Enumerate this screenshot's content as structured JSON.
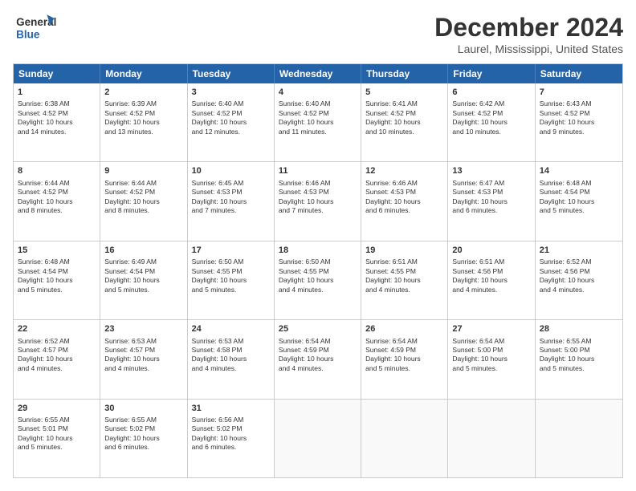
{
  "logo": {
    "line1": "General",
    "line2": "Blue"
  },
  "title": "December 2024",
  "location": "Laurel, Mississippi, United States",
  "days_of_week": [
    "Sunday",
    "Monday",
    "Tuesday",
    "Wednesday",
    "Thursday",
    "Friday",
    "Saturday"
  ],
  "weeks": [
    [
      {
        "day": "1",
        "lines": [
          "Sunrise: 6:38 AM",
          "Sunset: 4:52 PM",
          "Daylight: 10 hours",
          "and 14 minutes."
        ]
      },
      {
        "day": "2",
        "lines": [
          "Sunrise: 6:39 AM",
          "Sunset: 4:52 PM",
          "Daylight: 10 hours",
          "and 13 minutes."
        ]
      },
      {
        "day": "3",
        "lines": [
          "Sunrise: 6:40 AM",
          "Sunset: 4:52 PM",
          "Daylight: 10 hours",
          "and 12 minutes."
        ]
      },
      {
        "day": "4",
        "lines": [
          "Sunrise: 6:40 AM",
          "Sunset: 4:52 PM",
          "Daylight: 10 hours",
          "and 11 minutes."
        ]
      },
      {
        "day": "5",
        "lines": [
          "Sunrise: 6:41 AM",
          "Sunset: 4:52 PM",
          "Daylight: 10 hours",
          "and 10 minutes."
        ]
      },
      {
        "day": "6",
        "lines": [
          "Sunrise: 6:42 AM",
          "Sunset: 4:52 PM",
          "Daylight: 10 hours",
          "and 10 minutes."
        ]
      },
      {
        "day": "7",
        "lines": [
          "Sunrise: 6:43 AM",
          "Sunset: 4:52 PM",
          "Daylight: 10 hours",
          "and 9 minutes."
        ]
      }
    ],
    [
      {
        "day": "8",
        "lines": [
          "Sunrise: 6:44 AM",
          "Sunset: 4:52 PM",
          "Daylight: 10 hours",
          "and 8 minutes."
        ]
      },
      {
        "day": "9",
        "lines": [
          "Sunrise: 6:44 AM",
          "Sunset: 4:52 PM",
          "Daylight: 10 hours",
          "and 8 minutes."
        ]
      },
      {
        "day": "10",
        "lines": [
          "Sunrise: 6:45 AM",
          "Sunset: 4:53 PM",
          "Daylight: 10 hours",
          "and 7 minutes."
        ]
      },
      {
        "day": "11",
        "lines": [
          "Sunrise: 6:46 AM",
          "Sunset: 4:53 PM",
          "Daylight: 10 hours",
          "and 7 minutes."
        ]
      },
      {
        "day": "12",
        "lines": [
          "Sunrise: 6:46 AM",
          "Sunset: 4:53 PM",
          "Daylight: 10 hours",
          "and 6 minutes."
        ]
      },
      {
        "day": "13",
        "lines": [
          "Sunrise: 6:47 AM",
          "Sunset: 4:53 PM",
          "Daylight: 10 hours",
          "and 6 minutes."
        ]
      },
      {
        "day": "14",
        "lines": [
          "Sunrise: 6:48 AM",
          "Sunset: 4:54 PM",
          "Daylight: 10 hours",
          "and 5 minutes."
        ]
      }
    ],
    [
      {
        "day": "15",
        "lines": [
          "Sunrise: 6:48 AM",
          "Sunset: 4:54 PM",
          "Daylight: 10 hours",
          "and 5 minutes."
        ]
      },
      {
        "day": "16",
        "lines": [
          "Sunrise: 6:49 AM",
          "Sunset: 4:54 PM",
          "Daylight: 10 hours",
          "and 5 minutes."
        ]
      },
      {
        "day": "17",
        "lines": [
          "Sunrise: 6:50 AM",
          "Sunset: 4:55 PM",
          "Daylight: 10 hours",
          "and 5 minutes."
        ]
      },
      {
        "day": "18",
        "lines": [
          "Sunrise: 6:50 AM",
          "Sunset: 4:55 PM",
          "Daylight: 10 hours",
          "and 4 minutes."
        ]
      },
      {
        "day": "19",
        "lines": [
          "Sunrise: 6:51 AM",
          "Sunset: 4:55 PM",
          "Daylight: 10 hours",
          "and 4 minutes."
        ]
      },
      {
        "day": "20",
        "lines": [
          "Sunrise: 6:51 AM",
          "Sunset: 4:56 PM",
          "Daylight: 10 hours",
          "and 4 minutes."
        ]
      },
      {
        "day": "21",
        "lines": [
          "Sunrise: 6:52 AM",
          "Sunset: 4:56 PM",
          "Daylight: 10 hours",
          "and 4 minutes."
        ]
      }
    ],
    [
      {
        "day": "22",
        "lines": [
          "Sunrise: 6:52 AM",
          "Sunset: 4:57 PM",
          "Daylight: 10 hours",
          "and 4 minutes."
        ]
      },
      {
        "day": "23",
        "lines": [
          "Sunrise: 6:53 AM",
          "Sunset: 4:57 PM",
          "Daylight: 10 hours",
          "and 4 minutes."
        ]
      },
      {
        "day": "24",
        "lines": [
          "Sunrise: 6:53 AM",
          "Sunset: 4:58 PM",
          "Daylight: 10 hours",
          "and 4 minutes."
        ]
      },
      {
        "day": "25",
        "lines": [
          "Sunrise: 6:54 AM",
          "Sunset: 4:59 PM",
          "Daylight: 10 hours",
          "and 4 minutes."
        ]
      },
      {
        "day": "26",
        "lines": [
          "Sunrise: 6:54 AM",
          "Sunset: 4:59 PM",
          "Daylight: 10 hours",
          "and 5 minutes."
        ]
      },
      {
        "day": "27",
        "lines": [
          "Sunrise: 6:54 AM",
          "Sunset: 5:00 PM",
          "Daylight: 10 hours",
          "and 5 minutes."
        ]
      },
      {
        "day": "28",
        "lines": [
          "Sunrise: 6:55 AM",
          "Sunset: 5:00 PM",
          "Daylight: 10 hours",
          "and 5 minutes."
        ]
      }
    ],
    [
      {
        "day": "29",
        "lines": [
          "Sunrise: 6:55 AM",
          "Sunset: 5:01 PM",
          "Daylight: 10 hours",
          "and 5 minutes."
        ]
      },
      {
        "day": "30",
        "lines": [
          "Sunrise: 6:55 AM",
          "Sunset: 5:02 PM",
          "Daylight: 10 hours",
          "and 6 minutes."
        ]
      },
      {
        "day": "31",
        "lines": [
          "Sunrise: 6:56 AM",
          "Sunset: 5:02 PM",
          "Daylight: 10 hours",
          "and 6 minutes."
        ]
      },
      {
        "day": "",
        "lines": []
      },
      {
        "day": "",
        "lines": []
      },
      {
        "day": "",
        "lines": []
      },
      {
        "day": "",
        "lines": []
      }
    ]
  ]
}
